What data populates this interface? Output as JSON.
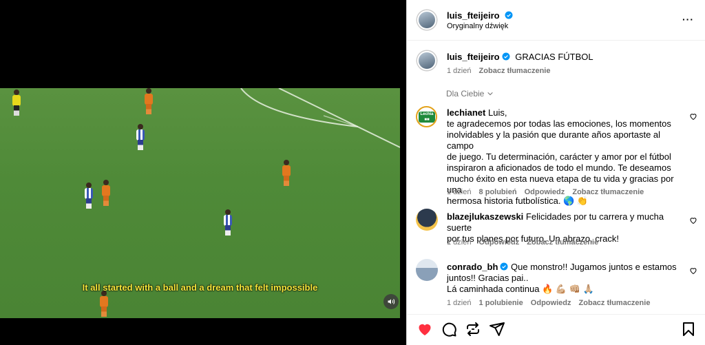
{
  "video": {
    "subtitle": "It all started with a ball and a dream that felt impossible"
  },
  "header": {
    "username": "luis_fteijeiro",
    "audio": "Oryginalny dźwięk",
    "more": "···"
  },
  "caption": {
    "username": "luis_fteijeiro",
    "text": "GRACIAS FÚTBOL",
    "time": "1 dzień",
    "translate": "Zobacz tłumaczenie"
  },
  "filter": {
    "label": "Dla Ciebie"
  },
  "comments": [
    {
      "username": "lechianet",
      "text_lines": [
        "Luis,",
        "te agradecemos por todas las emociones, los momentos",
        "inolvidables y la pasión que durante años aportaste al campo",
        "de juego. Tu determinación, carácter y amor por el fútbol",
        "inspiraron a aficionados de todo el mundo. Te deseamos",
        "mucho éxito en esta nueva etapa de tu vida y gracias por una",
        "hermosa historia futbolística. 🌎 👏"
      ],
      "time": "1 dzień",
      "likes": "8 polubień",
      "reply": "Odpowiedz",
      "translate": "Zobacz tłumaczenie",
      "avatar_text": "Lechia"
    },
    {
      "username": "blazejlukaszewski",
      "text_lines": [
        "Felicidades por tu carrera y mucha suerte",
        "por tus planes por futuro. Un abrazo, crack!"
      ],
      "time": "1 dzień",
      "reply": "Odpowiedz",
      "translate": "Zobacz tłumaczenie"
    },
    {
      "username": "conrado_bh",
      "text_lines": [
        "Que monstro!! Jugamos juntos e estamos",
        "juntos!! Gracias pai..",
        "Lá caminhada continua 🔥 💪🏼 👊🏼 🙏🏼"
      ],
      "time": "1 dzień",
      "likes": "1 polubienie",
      "reply": "Odpowiedz",
      "translate": "Zobacz tłumaczenie"
    }
  ],
  "colors": {
    "verified": "#0095f6",
    "like_active": "#ff3040",
    "meta_text": "#737373"
  },
  "icons": [
    "heart-icon",
    "comment-icon",
    "share-icon",
    "send-icon",
    "bookmark-icon",
    "speaker-icon",
    "chevron-down-icon",
    "more-icon"
  ]
}
